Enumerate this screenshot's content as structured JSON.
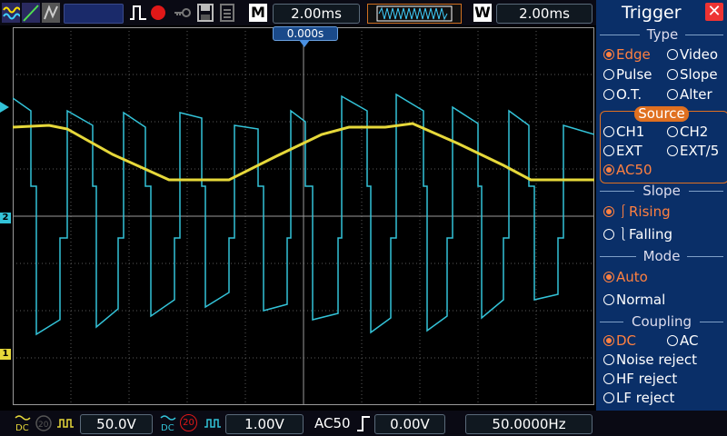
{
  "toolbar": {
    "mode_box_label": "M",
    "timebase_main": "2.00ms",
    "window_label": "W",
    "timebase_window": "2.00ms"
  },
  "screen": {
    "time_position": "0.000s",
    "ch2_marker": "2",
    "ch1_marker": "1",
    "ch1_color": "#e6d83a",
    "ch2_color": "#33c3d8"
  },
  "trigger_panel": {
    "title": "Trigger",
    "type_header": "Type",
    "type_options": [
      {
        "label": "Edge",
        "selected": true
      },
      {
        "label": "Video",
        "selected": false
      },
      {
        "label": "Pulse",
        "selected": false
      },
      {
        "label": "Slope",
        "selected": false
      },
      {
        "label": "O.T.",
        "selected": false
      },
      {
        "label": "Alter",
        "selected": false
      }
    ],
    "source_header": "Source",
    "source_options": [
      {
        "label": "CH1",
        "selected": false
      },
      {
        "label": "CH2",
        "selected": false
      },
      {
        "label": "EXT",
        "selected": false
      },
      {
        "label": "EXT/5",
        "selected": false
      },
      {
        "label": "AC50",
        "selected": true
      }
    ],
    "slope_header": "Slope",
    "slope_options": [
      {
        "label": "Rising",
        "selected": true
      },
      {
        "label": "Falling",
        "selected": false
      }
    ],
    "mode_header": "Mode",
    "mode_options": [
      {
        "label": "Auto",
        "selected": true
      },
      {
        "label": "Normal",
        "selected": false
      }
    ],
    "coupling_header": "Coupling",
    "coupling_options": [
      {
        "label": "DC",
        "selected": true
      },
      {
        "label": "AC",
        "selected": false
      },
      {
        "label": "Noise reject",
        "selected": false
      },
      {
        "label": "HF reject",
        "selected": false
      },
      {
        "label": "LF reject",
        "selected": false
      }
    ]
  },
  "statusbar": {
    "ch1_volts": "50.0V",
    "ch2_bw": "20",
    "ch2_volts": "1.00V",
    "trigger_source": "AC50",
    "trigger_level": "0.00V",
    "frequency": "50.0000Hz"
  }
}
